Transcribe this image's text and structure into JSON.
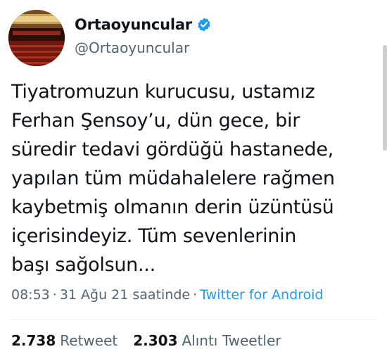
{
  "author": {
    "display_name": "Ortaoyuncular",
    "handle": "@Ortaoyuncular",
    "verified": true
  },
  "tweet": {
    "lines": [
      "Tiyatromuzun kurucusu, ustamız",
      "Ferhan Şensoy’u, dün gece, bir",
      "süredir tedavi gördüğü hastanede,",
      "yapılan tüm müdahalelere rağmen",
      "kaybetmiş olmanın derin üzüntüsü",
      "içerisindeyiz. Tüm sevenlerinin",
      "başı sağolsun..."
    ]
  },
  "meta": {
    "time": "08:53",
    "date": "31 Ağu 21 saatinde",
    "separator": "·",
    "source": "Twitter for Android"
  },
  "stats": {
    "retweets_count": "2.738",
    "retweets_label": "Retweet",
    "quotes_count": "2.303",
    "quotes_label": "Alıntı Tweetler"
  },
  "colors": {
    "text": "#0f1419",
    "secondary": "#536471",
    "accent": "#1d9bf0"
  }
}
